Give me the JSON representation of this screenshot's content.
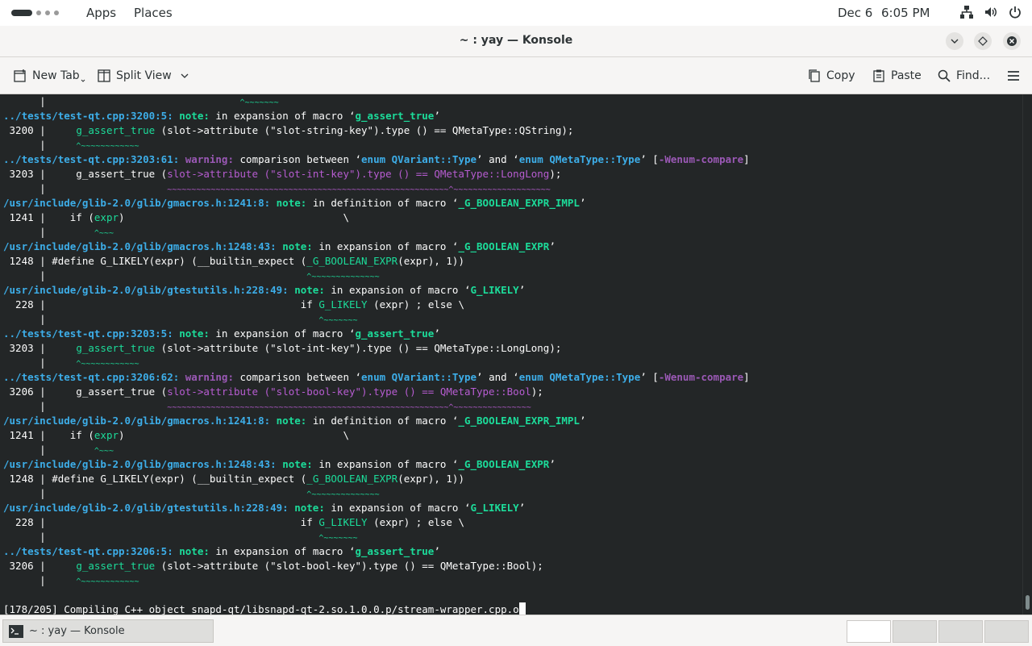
{
  "topbar": {
    "apps_label": "Apps",
    "places_label": "Places",
    "date": "Dec 6",
    "time": "6:05 PM"
  },
  "window": {
    "title": "~ : yay — Konsole"
  },
  "toolbar": {
    "new_tab": "New Tab",
    "split_view": "Split View",
    "copy": "Copy",
    "paste": "Paste",
    "find": "Find..."
  },
  "terminal": {
    "lines": [
      [
        {
          "t": "      |",
          "c": ""
        },
        {
          "t": "                                        ^~~~~~~~",
          "c": "tilde"
        }
      ],
      [
        {
          "t": "../tests/test-qt.cpp:3200:5: ",
          "c": "blue"
        },
        {
          "t": "note: ",
          "c": "greenb"
        },
        {
          "t": "in expansion of macro ‘",
          "c": ""
        },
        {
          "t": "g_assert_true",
          "c": "greenb"
        },
        {
          "t": "’",
          "c": ""
        }
      ],
      [
        {
          "t": " 3200 |     ",
          "c": ""
        },
        {
          "t": "g_assert_true",
          "c": "green"
        },
        {
          "t": " (slot->attribute (\"slot-string-key\").type () == QMetaType::QString);",
          "c": ""
        }
      ],
      [
        {
          "t": "      |     ",
          "c": ""
        },
        {
          "t": "^~~~~~~~~~~~~",
          "c": "tilde"
        }
      ],
      [
        {
          "t": "../tests/test-qt.cpp:3203:61: ",
          "c": "blue"
        },
        {
          "t": "warning: ",
          "c": "mag"
        },
        {
          "t": "comparison between ‘",
          "c": ""
        },
        {
          "t": "enum QVariant::Type",
          "c": "blue"
        },
        {
          "t": "’ and ‘",
          "c": ""
        },
        {
          "t": "enum QMetaType::Type",
          "c": "blue"
        },
        {
          "t": "’ [",
          "c": ""
        },
        {
          "t": "-Wenum-compare",
          "c": "mag"
        },
        {
          "t": "]",
          "c": ""
        }
      ],
      [
        {
          "t": " 3203 |     g_assert_true (",
          "c": ""
        },
        {
          "t": "slot->attribute (\"slot-int-key\").type () == QMetaType::LongLong",
          "c": "magn"
        },
        {
          "t": ");",
          "c": ""
        }
      ],
      [
        {
          "t": "      |                    ",
          "c": ""
        },
        {
          "t": "~~~~~~~~~~~~~~~~~~~~~~~~~~~~~~~~~~~~~~~~~~~~~~~~~~~~~~~~~~^~~~~~~~~~~~~~~~~~~~~",
          "c": "tildem"
        }
      ],
      [
        {
          "t": "/usr/include/glib-2.0/glib/gmacros.h:1241:8: ",
          "c": "blue"
        },
        {
          "t": "note: ",
          "c": "greenb"
        },
        {
          "t": "in definition of macro ‘",
          "c": ""
        },
        {
          "t": "_G_BOOLEAN_EXPR_IMPL",
          "c": "greenb"
        },
        {
          "t": "’",
          "c": ""
        }
      ],
      [
        {
          "t": " 1241 |    if (",
          "c": ""
        },
        {
          "t": "expr",
          "c": "green"
        },
        {
          "t": ")                                    \\",
          "c": ""
        }
      ],
      [
        {
          "t": "      |        ",
          "c": ""
        },
        {
          "t": "^~~~",
          "c": "tilde"
        }
      ],
      [
        {
          "t": "/usr/include/glib-2.0/glib/gmacros.h:1248:43: ",
          "c": "blue"
        },
        {
          "t": "note: ",
          "c": "greenb"
        },
        {
          "t": "in expansion of macro ‘",
          "c": ""
        },
        {
          "t": "_G_BOOLEAN_EXPR",
          "c": "greenb"
        },
        {
          "t": "’",
          "c": ""
        }
      ],
      [
        {
          "t": " 1248 | #define G_LIKELY(expr) (__builtin_expect (",
          "c": ""
        },
        {
          "t": "_G_BOOLEAN_EXPR",
          "c": "green"
        },
        {
          "t": "(expr), 1))",
          "c": ""
        }
      ],
      [
        {
          "t": "      |                                           ",
          "c": ""
        },
        {
          "t": "^~~~~~~~~~~~~~~",
          "c": "tilde"
        }
      ],
      [
        {
          "t": "/usr/include/glib-2.0/glib/gtestutils.h:228:49: ",
          "c": "blue"
        },
        {
          "t": "note: ",
          "c": "greenb"
        },
        {
          "t": "in expansion of macro ‘",
          "c": ""
        },
        {
          "t": "G_LIKELY",
          "c": "greenb"
        },
        {
          "t": "’",
          "c": ""
        }
      ],
      [
        {
          "t": "  228 |                                          if ",
          "c": ""
        },
        {
          "t": "G_LIKELY",
          "c": "green"
        },
        {
          "t": " (expr) ; else \\",
          "c": ""
        }
      ],
      [
        {
          "t": "      |                                             ",
          "c": ""
        },
        {
          "t": "^~~~~~~~",
          "c": "tilde"
        }
      ],
      [
        {
          "t": "../tests/test-qt.cpp:3203:5: ",
          "c": "blue"
        },
        {
          "t": "note: ",
          "c": "greenb"
        },
        {
          "t": "in expansion of macro ‘",
          "c": ""
        },
        {
          "t": "g_assert_true",
          "c": "greenb"
        },
        {
          "t": "’",
          "c": ""
        }
      ],
      [
        {
          "t": " 3203 |     ",
          "c": ""
        },
        {
          "t": "g_assert_true",
          "c": "green"
        },
        {
          "t": " (slot->attribute (\"slot-int-key\").type () == QMetaType::LongLong);",
          "c": ""
        }
      ],
      [
        {
          "t": "      |     ",
          "c": ""
        },
        {
          "t": "^~~~~~~~~~~~~",
          "c": "tilde"
        }
      ],
      [
        {
          "t": "../tests/test-qt.cpp:3206:62: ",
          "c": "blue"
        },
        {
          "t": "warning: ",
          "c": "mag"
        },
        {
          "t": "comparison between ‘",
          "c": ""
        },
        {
          "t": "enum QVariant::Type",
          "c": "blue"
        },
        {
          "t": "’ and ‘",
          "c": ""
        },
        {
          "t": "enum QMetaType::Type",
          "c": "blue"
        },
        {
          "t": "’ [",
          "c": ""
        },
        {
          "t": "-Wenum-compare",
          "c": "mag"
        },
        {
          "t": "]",
          "c": ""
        }
      ],
      [
        {
          "t": " 3206 |     g_assert_true (",
          "c": ""
        },
        {
          "t": "slot->attribute (\"slot-bool-key\").type () == QMetaType::Bool",
          "c": "magn"
        },
        {
          "t": ");",
          "c": ""
        }
      ],
      [
        {
          "t": "      |                    ",
          "c": ""
        },
        {
          "t": "~~~~~~~~~~~~~~~~~~~~~~~~~~~~~~~~~~~~~~~~~~~~~~~~~~~~~~~~~~^~~~~~~~~~~~~~~~~",
          "c": "tildem"
        }
      ],
      [
        {
          "t": "/usr/include/glib-2.0/glib/gmacros.h:1241:8: ",
          "c": "blue"
        },
        {
          "t": "note: ",
          "c": "greenb"
        },
        {
          "t": "in definition of macro ‘",
          "c": ""
        },
        {
          "t": "_G_BOOLEAN_EXPR_IMPL",
          "c": "greenb"
        },
        {
          "t": "’",
          "c": ""
        }
      ],
      [
        {
          "t": " 1241 |    if (",
          "c": ""
        },
        {
          "t": "expr",
          "c": "green"
        },
        {
          "t": ")                                    \\",
          "c": ""
        }
      ],
      [
        {
          "t": "      |        ",
          "c": ""
        },
        {
          "t": "^~~~",
          "c": "tilde"
        }
      ],
      [
        {
          "t": "/usr/include/glib-2.0/glib/gmacros.h:1248:43: ",
          "c": "blue"
        },
        {
          "t": "note: ",
          "c": "greenb"
        },
        {
          "t": "in expansion of macro ‘",
          "c": ""
        },
        {
          "t": "_G_BOOLEAN_EXPR",
          "c": "greenb"
        },
        {
          "t": "’",
          "c": ""
        }
      ],
      [
        {
          "t": " 1248 | #define G_LIKELY(expr) (__builtin_expect (",
          "c": ""
        },
        {
          "t": "_G_BOOLEAN_EXPR",
          "c": "green"
        },
        {
          "t": "(expr), 1))",
          "c": ""
        }
      ],
      [
        {
          "t": "      |                                           ",
          "c": ""
        },
        {
          "t": "^~~~~~~~~~~~~~~",
          "c": "tilde"
        }
      ],
      [
        {
          "t": "/usr/include/glib-2.0/glib/gtestutils.h:228:49: ",
          "c": "blue"
        },
        {
          "t": "note: ",
          "c": "greenb"
        },
        {
          "t": "in expansion of macro ‘",
          "c": ""
        },
        {
          "t": "G_LIKELY",
          "c": "greenb"
        },
        {
          "t": "’",
          "c": ""
        }
      ],
      [
        {
          "t": "  228 |                                          if ",
          "c": ""
        },
        {
          "t": "G_LIKELY",
          "c": "green"
        },
        {
          "t": " (expr) ; else \\",
          "c": ""
        }
      ],
      [
        {
          "t": "      |                                             ",
          "c": ""
        },
        {
          "t": "^~~~~~~~",
          "c": "tilde"
        }
      ],
      [
        {
          "t": "../tests/test-qt.cpp:3206:5: ",
          "c": "blue"
        },
        {
          "t": "note: ",
          "c": "greenb"
        },
        {
          "t": "in expansion of macro ‘",
          "c": ""
        },
        {
          "t": "g_assert_true",
          "c": "greenb"
        },
        {
          "t": "’",
          "c": ""
        }
      ],
      [
        {
          "t": " 3206 |     ",
          "c": ""
        },
        {
          "t": "g_assert_true",
          "c": "green"
        },
        {
          "t": " (slot->attribute (\"slot-bool-key\").type () == QMetaType::Bool);",
          "c": ""
        }
      ],
      [
        {
          "t": "      |     ",
          "c": ""
        },
        {
          "t": "^~~~~~~~~~~~~",
          "c": "tilde"
        }
      ],
      [
        {
          "t": "",
          "c": ""
        }
      ],
      [
        {
          "t": "[178/205] Compiling C++ object snapd-qt/libsnapd-qt-2.so.1.0.0.p/stream-wrapper.cpp.o",
          "c": ""
        },
        {
          "t": "",
          "c": "cursor"
        }
      ]
    ]
  },
  "taskbar": {
    "task_label": "~ : yay — Konsole"
  },
  "colors": {
    "terminal_bg": "#232627",
    "path_blue": "#3daee9",
    "note_green": "#1cdc9a",
    "warning_magenta": "#9b59b6"
  }
}
